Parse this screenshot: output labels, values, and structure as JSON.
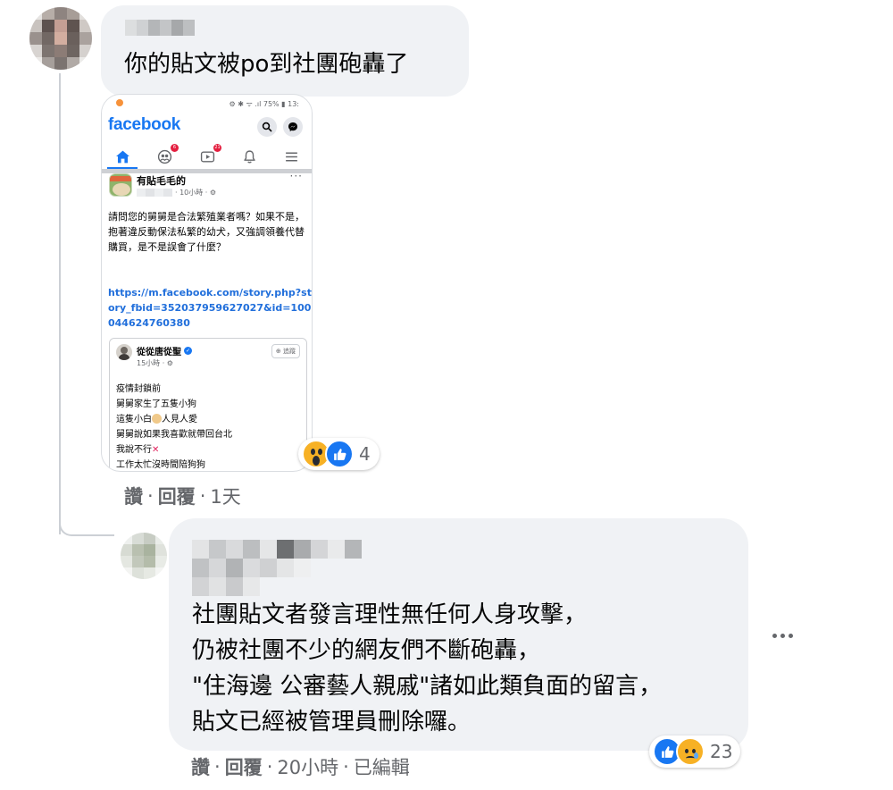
{
  "comment_1": {
    "author_name": "",
    "text": "你的貼文被po到社團砲轟了",
    "actions": {
      "like": "讚",
      "reply": "回覆",
      "time": "1天"
    },
    "reactions": {
      "icons": [
        "wow-icon",
        "like-icon"
      ],
      "count": "4"
    },
    "attachment": {
      "status_bar": "⚙ ✱ ᯤ .ıl 75% ▮ 13:",
      "app_name": "facebook",
      "nav_badges": {
        "friends": "6",
        "watch": "21"
      },
      "post": {
        "group_name": "有貼毛毛的",
        "meta": "· 10小時 · ⚙",
        "more": "···",
        "text": "請問您的舅舅是合法繁殖業者嗎？如果不是，抱著違反動保法私繁的幼犬，又強調領養代替購買，是不是誤會了什麼？",
        "link": "https://m.facebook.com/story.php?story_fbid=352037959627027&id=100044624760380"
      },
      "shared_post": {
        "author": "從從唐從聖",
        "meta": "15小時 · ⚙",
        "follow": "⊕ 追蹤",
        "lines": {
          "l1": "疫情封鎖前",
          "l2": "舅舅家生了五隻小狗",
          "l3_a": "這隻小白",
          "l3_b": "人見人愛",
          "l4": "舅舅說如果我喜歡就帶回台北",
          "l5_a": "我說不行",
          "l5_x": "✕",
          "l6": "工作太忙沒時間陪狗狗"
        }
      }
    }
  },
  "comment_2": {
    "author_name": "",
    "lines": [
      "社團貼文者發言理性無任何人身攻擊，",
      "仍被社團不少的網友們不斷砲轟，",
      "\"住海邊 公審藝人親戚\"諸如此類負面的留言，",
      "貼文已經被管理員刪除囉。"
    ],
    "actions": {
      "like": "讚",
      "reply": "回覆",
      "time": "20小時",
      "edited": "已編輯"
    },
    "reactions": {
      "icons": [
        "like-icon",
        "sad-icon"
      ],
      "count": "23"
    }
  },
  "colors": {
    "bubble": "#f0f2f5",
    "secondary_text": "#65676b",
    "facebook_blue": "#1877f2",
    "link_blue": "#216fdb",
    "reaction_yellow": "#f7b125"
  }
}
